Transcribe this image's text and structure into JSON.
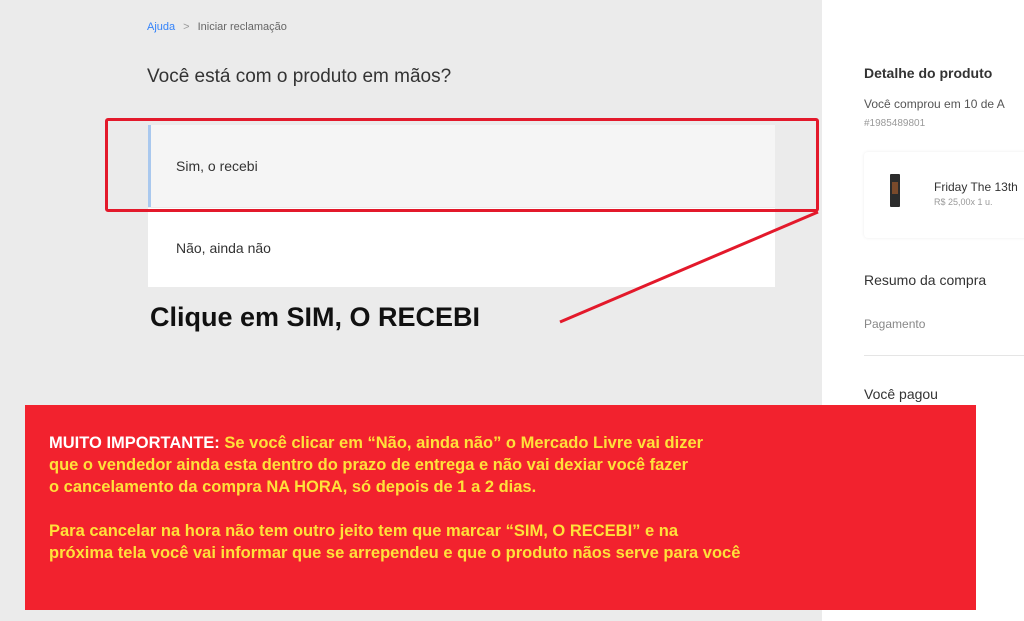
{
  "breadcrumb": {
    "home": "Ajuda",
    "separator": ">",
    "current": "Iniciar reclamação"
  },
  "question": "Você está com o produto em mãos?",
  "options": [
    {
      "label": "Sim, o recebi"
    },
    {
      "label": "Não, ainda não"
    }
  ],
  "annotation": {
    "callout": "Clique em SIM, O RECEBI",
    "color": "#e3192b"
  },
  "sidebar": {
    "title": "Detalhe do produto",
    "bought": "Você comprou em 10 de A",
    "order": "#1985489801",
    "product": {
      "name": "Friday The 13th",
      "price": "R$ 25,00x 1 u."
    },
    "summary": "Resumo da compra",
    "payment": "Pagamento",
    "paid": "Você pagou"
  },
  "notice": {
    "label": "MUITO IMPORTANTE:",
    "line1": " Se você clicar em “Não, ainda não” o Mercado Livre vai dizer",
    "line2": "que o vendedor ainda esta dentro do prazo de entrega e não vai dexiar você fazer",
    "line3": "o cancelamento da compra NA HORA, só depois de 1 a 2 dias.",
    "line4": "Para cancelar na hora não tem outro jeito tem que marcar “SIM, O RECEBI” e na",
    "line5": "próxima tela você vai informar que se arrependeu e que o produto nãos serve para você",
    "background": "#f2222e",
    "text_color": "#ffe13a"
  }
}
